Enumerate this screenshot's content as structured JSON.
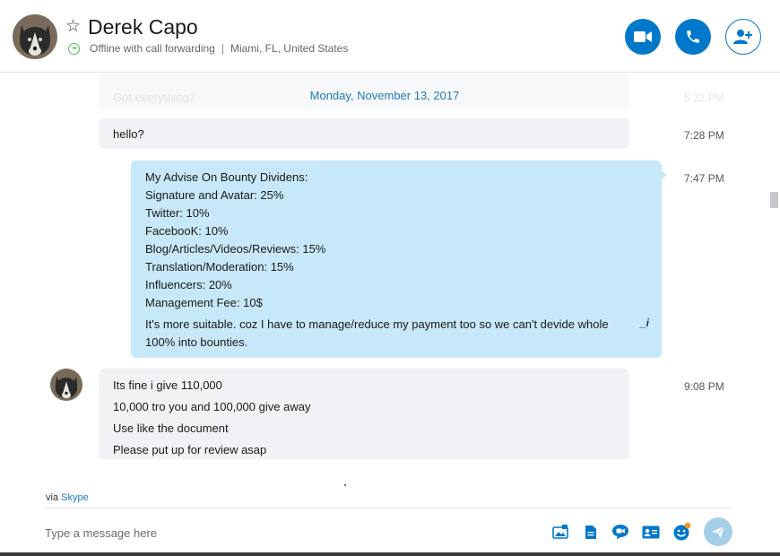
{
  "header": {
    "name": "Derek Capo",
    "status": "Offline with call forwarding",
    "location": "Miami, FL, United States",
    "separator": "|"
  },
  "conversation": {
    "faded_message": "Got everything?",
    "faded_time": "5:22 PM",
    "date_separator": "Monday, November 13, 2017",
    "messages": [
      {
        "direction": "incoming",
        "time": "7:28 PM",
        "lines": [
          "hello?"
        ]
      },
      {
        "direction": "outgoing",
        "time": "7:47 PM",
        "lines": [
          "My Advise On Bounty Dividens:",
          "Signature and Avatar: 25%",
          "Twitter: 10%",
          "FacebooK: 10%",
          "Blog/Articles/Videos/Reviews: 15%",
          "Translation/Moderation: 15%",
          "Influencers: 20%",
          "Management Fee: 10$",
          "It's more suitable. coz I have to manage/reduce my payment too so we can't devide whole",
          "100% into bounties."
        ],
        "edited_marker": "_i"
      },
      {
        "direction": "incoming",
        "time": "9:08 PM",
        "lines": [
          "Its fine i give 110,000",
          "10,000 tro you and 100,000 give away",
          "Use like the document",
          "Please put up for review asap"
        ]
      }
    ]
  },
  "footer": {
    "via_prefix": "via",
    "via_link": "Skype",
    "compose_placeholder": "Type a message here",
    "tools": [
      "media-icon",
      "file-icon",
      "video-message-icon",
      "contact-card-icon",
      "emoticon-icon",
      "send-icon"
    ]
  },
  "colors": {
    "accent": "#0078ca",
    "outgoing_bubble": "#c7e8f8",
    "incoming_bubble": "#f0f2f5",
    "link": "#1f7ab8",
    "send_button": "#a5cfe9"
  }
}
